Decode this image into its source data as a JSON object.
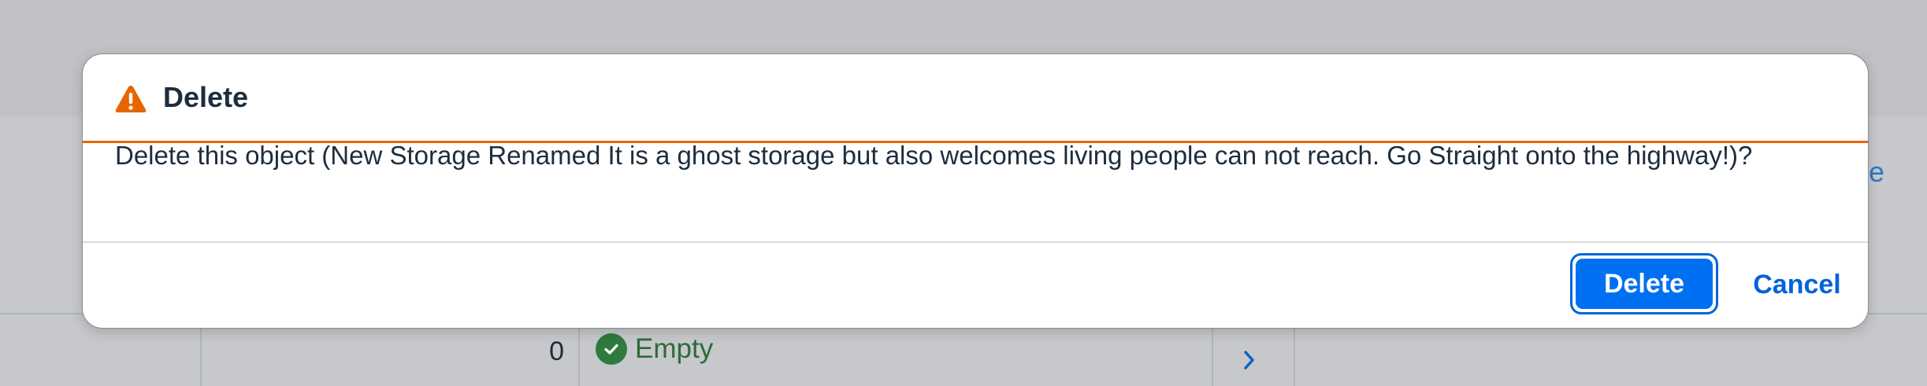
{
  "dialog": {
    "title": "Delete",
    "message": "Delete this object (New Storage Renamed It is a ghost storage but also welcomes living people can not reach. Go Straight onto the highway!)?",
    "confirm_label": "Delete",
    "cancel_label": "Cancel",
    "icon": "warning-icon"
  },
  "background": {
    "edge_link_text": "te",
    "row": {
      "count": "0",
      "status": "Empty",
      "status_icon": "check-circle-icon",
      "nav_icon": "chevron-right-icon"
    }
  },
  "colors": {
    "accent": "#0070f2",
    "warning": "#e76500",
    "success": "#2f7a3f",
    "text": "#1d2d3e"
  }
}
